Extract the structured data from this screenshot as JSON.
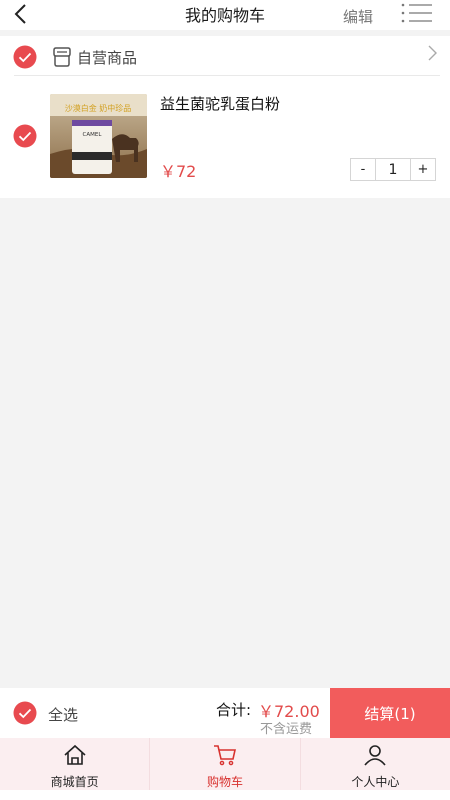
{
  "header": {
    "title": "我的购物车",
    "edit_label": "编辑",
    "back_icon": "chevron-left-icon",
    "menu_icon": "list-menu-icon"
  },
  "cart": {
    "shop": {
      "name": "自营商品",
      "icon": "store-icon",
      "checked": true
    },
    "items": [
      {
        "name": "益生菌驼乳蛋白粉",
        "price": "￥72",
        "quantity": "1",
        "checked": true,
        "image_text_top": "沙漠白金 奶中珍品",
        "image_text_brand": "CAMEL"
      }
    ],
    "stepper": {
      "minus": "-",
      "plus": "+"
    }
  },
  "footer": {
    "select_all_label": "全选",
    "total_label": "合计:",
    "total_amount": "￥72.00",
    "shipping_note": "不含运费",
    "checkout_label": "结算(1)"
  },
  "tabs": [
    {
      "label": "商城首页",
      "icon": "home-icon",
      "active": false
    },
    {
      "label": "购物车",
      "icon": "cart-icon",
      "active": true
    },
    {
      "label": "个人中心",
      "icon": "user-icon",
      "active": false
    }
  ],
  "colors": {
    "accent": "#e24b4b",
    "checkout": "#f25c5c",
    "check": "#e84a4f",
    "tab_bar_bg": "#fbeef0"
  }
}
